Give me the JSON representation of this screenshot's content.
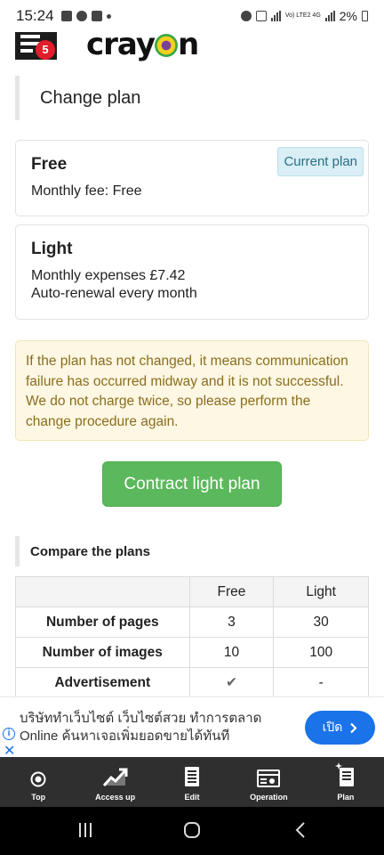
{
  "status_bar": {
    "time": "15:24",
    "network": "Vo) LTE2 4G",
    "battery": "2%"
  },
  "header": {
    "menu_badge": "5",
    "logo_text_pre": "cray",
    "logo_text_post": "n"
  },
  "section": {
    "title": "Change plan"
  },
  "plans": {
    "free": {
      "name": "Free",
      "fee": "Monthly fee: Free",
      "badge": "Current plan"
    },
    "light": {
      "name": "Light",
      "expenses": "Monthly expenses £7.42",
      "renewal": "Auto-renewal every month"
    }
  },
  "alert": {
    "text": "If the plan has not changed, it means communication failure has occurred midway and it is not successful. We do not charge twice, so please perform the change procedure again."
  },
  "cta": {
    "label": "Contract light plan"
  },
  "compare": {
    "title": "Compare the plans",
    "columns": [
      "",
      "Free",
      "Light"
    ],
    "rows": [
      {
        "label": "Number of pages",
        "free": "3",
        "light": "30"
      },
      {
        "label": "Number of images",
        "free": "10",
        "light": "100"
      },
      {
        "label": "Advertisement",
        "free": "✔",
        "light": "-"
      }
    ]
  },
  "ad": {
    "line1": "บริษัททำเว็บไซต์ เว็บไซต์สวย ทำการตลาด",
    "line2": "Online ค้นหาเจอเพิ่มยอดขายได้ทันที",
    "button": "เปิด"
  },
  "tabs": [
    {
      "label": "Top",
      "icon": "top-icon"
    },
    {
      "label": "Access up",
      "icon": "trend-up-icon"
    },
    {
      "label": "Edit",
      "icon": "edit-icon"
    },
    {
      "label": "Operation",
      "icon": "operation-icon"
    },
    {
      "label": "Plan",
      "icon": "plan-icon"
    }
  ]
}
